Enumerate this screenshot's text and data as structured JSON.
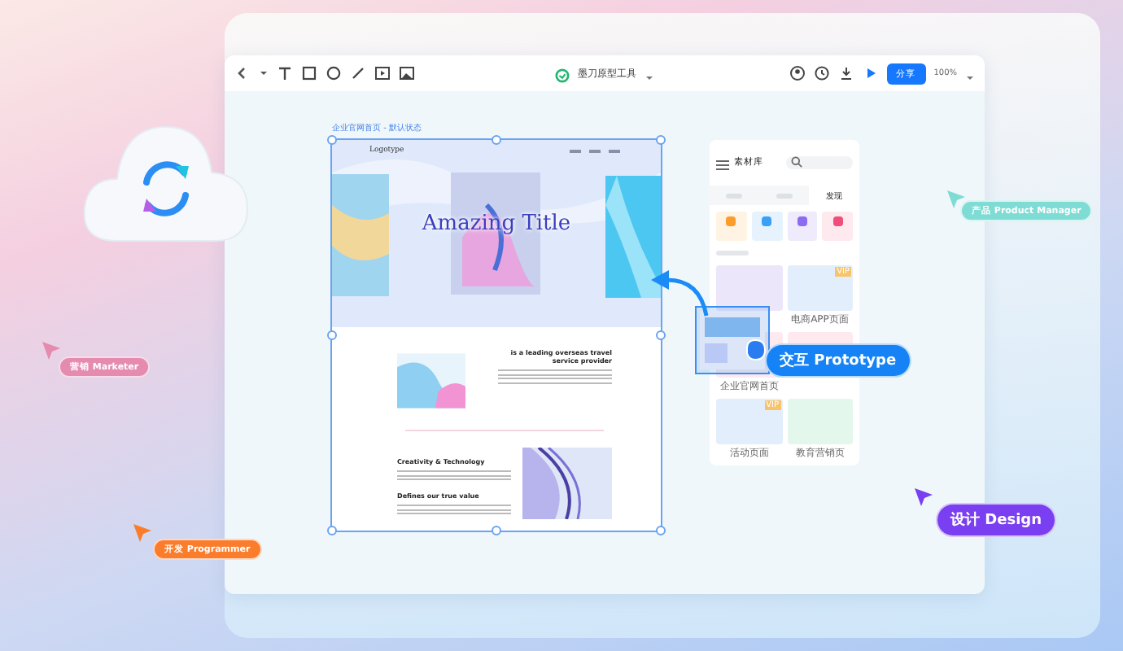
{
  "toolbar": {
    "title": "墨刀原型工具",
    "share_button": "分享",
    "zoom": "100%"
  },
  "artboard": {
    "label": "企业官网首页 - 默认状态",
    "site": {
      "logo": "Logotype",
      "hero_title": "Amazing Title",
      "intro_heading": "is a leading overseas travel service provider",
      "sections": [
        "Creativity & Technology",
        "Defines our true value"
      ]
    }
  },
  "library": {
    "title": "素材库",
    "tabs": [
      {
        "label": "发现",
        "selected": true
      }
    ],
    "templates": [
      {
        "color": "#ece6fb"
      },
      {
        "label": "电商APP页面",
        "color": "#e3eefc",
        "badge": "VIP"
      },
      {
        "label": "企业官网首页",
        "color": "#fde9ee"
      },
      {
        "color": "#fde9ee"
      },
      {
        "label": "活动页面",
        "color": "#e3eefc",
        "badge": "VIP"
      },
      {
        "label": "教育营销页",
        "color": "#e3f7ec"
      }
    ]
  },
  "roles": [
    {
      "label": "营销 Marketer",
      "color": "#e58bb0"
    },
    {
      "label": "开发 Programmer",
      "color": "#fb7d2c"
    },
    {
      "label": "产品 Product Manager",
      "color": "#7fdcd4"
    },
    {
      "label": "交互 Prototype",
      "color": "#1583f5"
    },
    {
      "label": "设计 Design",
      "color": "#7a3ff0"
    }
  ]
}
